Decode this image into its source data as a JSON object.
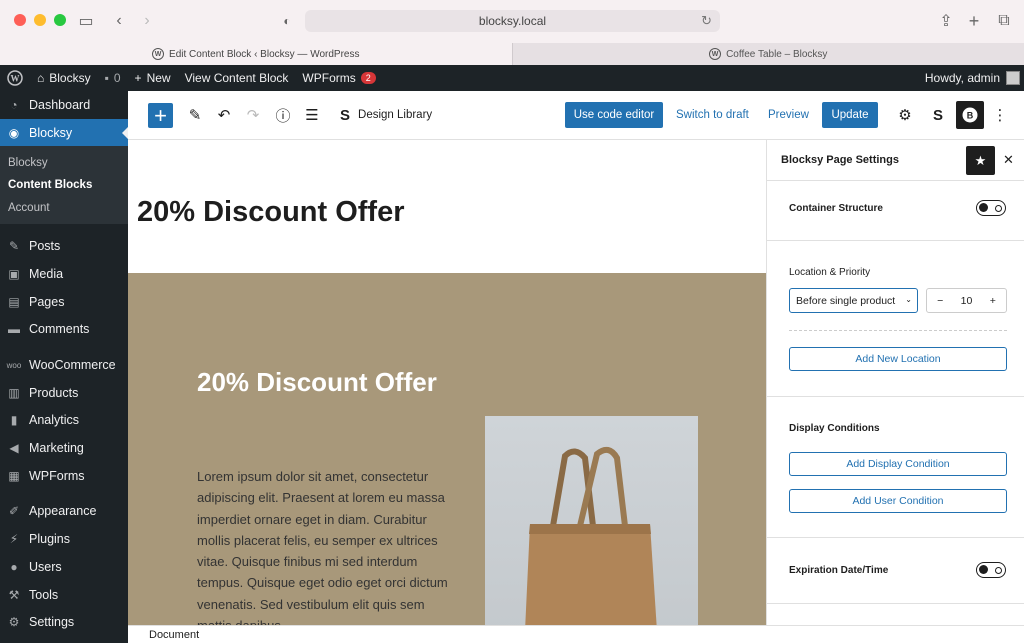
{
  "browser": {
    "url": "blocksy.local",
    "tabs": [
      {
        "title": "Edit Content Block ‹ Blocksy — WordPress"
      },
      {
        "title": "Coffee Table – Blocksy"
      }
    ]
  },
  "adminbar": {
    "site": "Blocksy",
    "comments_count": "0",
    "new_label": "New",
    "view_label": "View Content Block",
    "wpforms_label": "WPForms",
    "wpforms_badge": "2",
    "greeting": "Howdy, admin"
  },
  "sidebar": {
    "top": [
      {
        "label": "Dashboard",
        "icon": "dashboard-icon"
      },
      {
        "label": "Blocksy",
        "icon": "blocksy-icon"
      }
    ],
    "submenu": [
      "Blocksy",
      "Content Blocks",
      "Account"
    ],
    "groups": [
      [
        {
          "label": "Posts",
          "icon": "pin-icon"
        },
        {
          "label": "Media",
          "icon": "media-icon"
        },
        {
          "label": "Pages",
          "icon": "pages-icon"
        },
        {
          "label": "Comments",
          "icon": "comments-icon"
        }
      ],
      [
        {
          "label": "WooCommerce",
          "icon": "woo-icon"
        },
        {
          "label": "Products",
          "icon": "products-icon"
        },
        {
          "label": "Analytics",
          "icon": "analytics-icon"
        },
        {
          "label": "Marketing",
          "icon": "megaphone-icon"
        },
        {
          "label": "WPForms",
          "icon": "wpforms-icon"
        }
      ],
      [
        {
          "label": "Appearance",
          "icon": "brush-icon"
        },
        {
          "label": "Plugins",
          "icon": "plugin-icon"
        },
        {
          "label": "Users",
          "icon": "users-icon"
        },
        {
          "label": "Tools",
          "icon": "wrench-icon"
        },
        {
          "label": "Settings",
          "icon": "settings-icon"
        }
      ]
    ]
  },
  "toolbar": {
    "design_library": "Design Library",
    "code_editor": "Use code editor",
    "switch_draft": "Switch to draft",
    "preview": "Preview",
    "update": "Update"
  },
  "canvas": {
    "post_title": "20% Discount Offer",
    "hero_title": "20% Discount Offer",
    "hero_text": "Lorem ipsum dolor sit amet, consectetur adipiscing elit. Praesent at lorem eu massa imperdiet ornare eget in diam. Curabitur mollis placerat felis, eu semper ex ultrices vitae. Quisque finibus mi sed interdum tempus. Quisque eget odio eget orci dictum venenatis. Sed vestibulum elit quis sem mattis dapibus."
  },
  "statusbar": {
    "breadcrumb": "Document"
  },
  "panel": {
    "title": "Blocksy Page Settings",
    "container_structure": "Container Structure",
    "location_priority": "Location & Priority",
    "location_value": "Before single product",
    "priority_value": "10",
    "add_location": "Add New Location",
    "display_conditions": "Display Conditions",
    "add_display_condition": "Add Display Condition",
    "add_user_condition": "Add User Condition",
    "expiration": "Expiration Date/Time"
  },
  "colors": {
    "accent": "#2271b1",
    "admin_dark": "#1d2327",
    "hero_bg": "#a8987a"
  }
}
